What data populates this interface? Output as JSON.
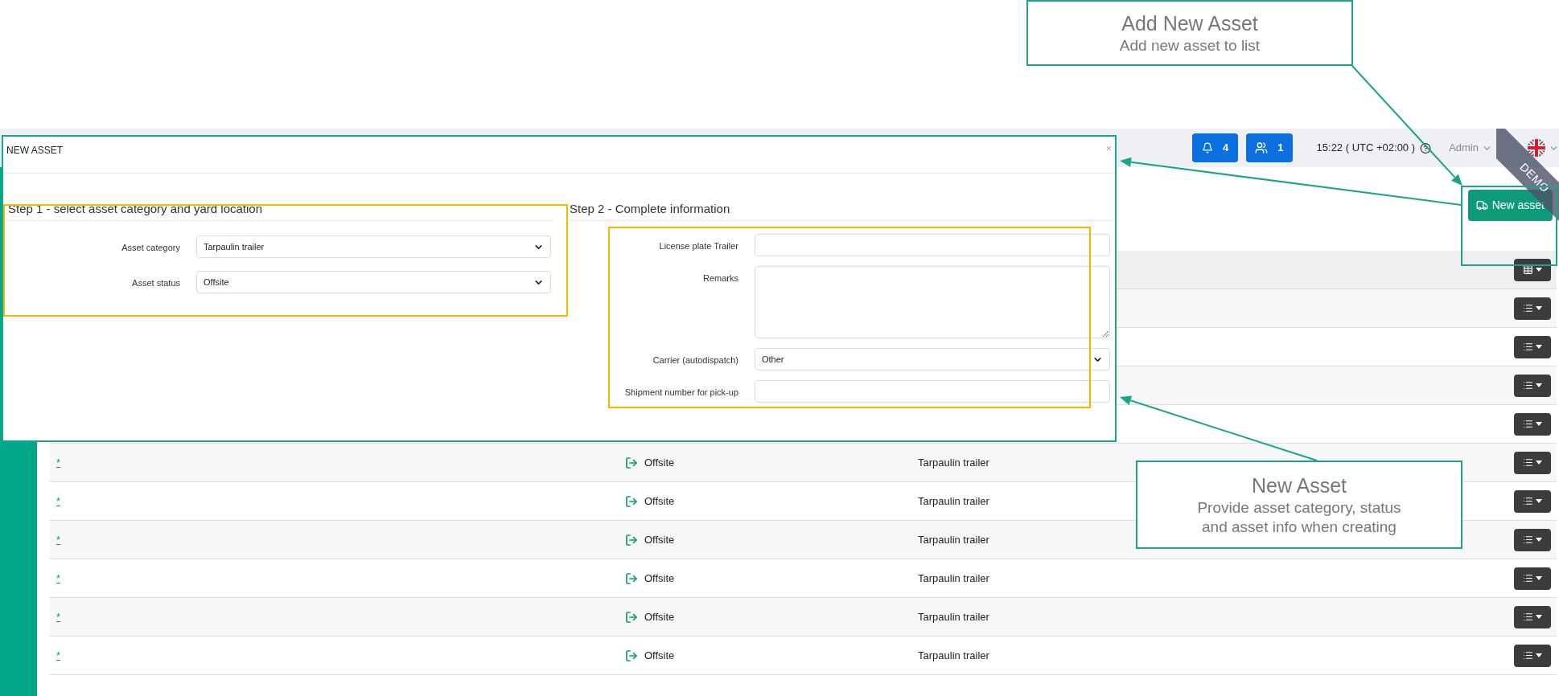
{
  "callouts": [
    {
      "title": "Add New Asset",
      "lines": [
        "Add new asset to list"
      ]
    },
    {
      "title": "New Asset",
      "lines": [
        "Provide asset category, status",
        "and asset info when creating"
      ]
    }
  ],
  "header": {
    "notifications": "4",
    "users": "1",
    "time": "15:22 ( UTC +02:00 )",
    "user": "Admin",
    "ribbon": "DEMO"
  },
  "toolbar": {
    "new_button": "New asset"
  },
  "table": {
    "rows": [
      {
        "kind": "covered"
      },
      {
        "kind": "covered"
      },
      {
        "kind": "covered"
      },
      {
        "kind": "covered"
      },
      {
        "kind": "entry",
        "name": "*",
        "status": "Offsite",
        "category": "Tarpaulin trailer"
      },
      {
        "kind": "entry",
        "name": "*",
        "status": "Offsite",
        "category": "Tarpaulin trailer"
      },
      {
        "kind": "entry",
        "name": "*",
        "status": "Offsite",
        "category": "Tarpaulin trailer"
      },
      {
        "kind": "entry",
        "name": "*",
        "status": "Offsite",
        "category": "Tarpaulin trailer"
      },
      {
        "kind": "entry",
        "name": "*",
        "status": "Offsite",
        "category": "Tarpaulin trailer"
      },
      {
        "kind": "entry",
        "name": "*",
        "status": "Offsite",
        "category": "Tarpaulin trailer"
      }
    ]
  },
  "dialog": {
    "title": "NEW ASSET",
    "close": "×",
    "steps": [
      {
        "heading": "Step 1 - select asset category and yard location",
        "fields": [
          {
            "kind": "select",
            "label": "Asset category",
            "value": "Tarpaulin trailer"
          },
          {
            "kind": "select",
            "label": "Asset status",
            "value": "Offsite"
          }
        ]
      },
      {
        "heading": "Step 2 - Complete information",
        "fields": [
          {
            "kind": "input",
            "label": "License plate Trailer"
          },
          {
            "kind": "textarea",
            "label": "Remarks"
          },
          {
            "kind": "select",
            "label": "Carrier (autodispatch)",
            "value": "Other"
          },
          {
            "kind": "input",
            "label": "Shipment number for pick-up"
          }
        ]
      }
    ]
  }
}
